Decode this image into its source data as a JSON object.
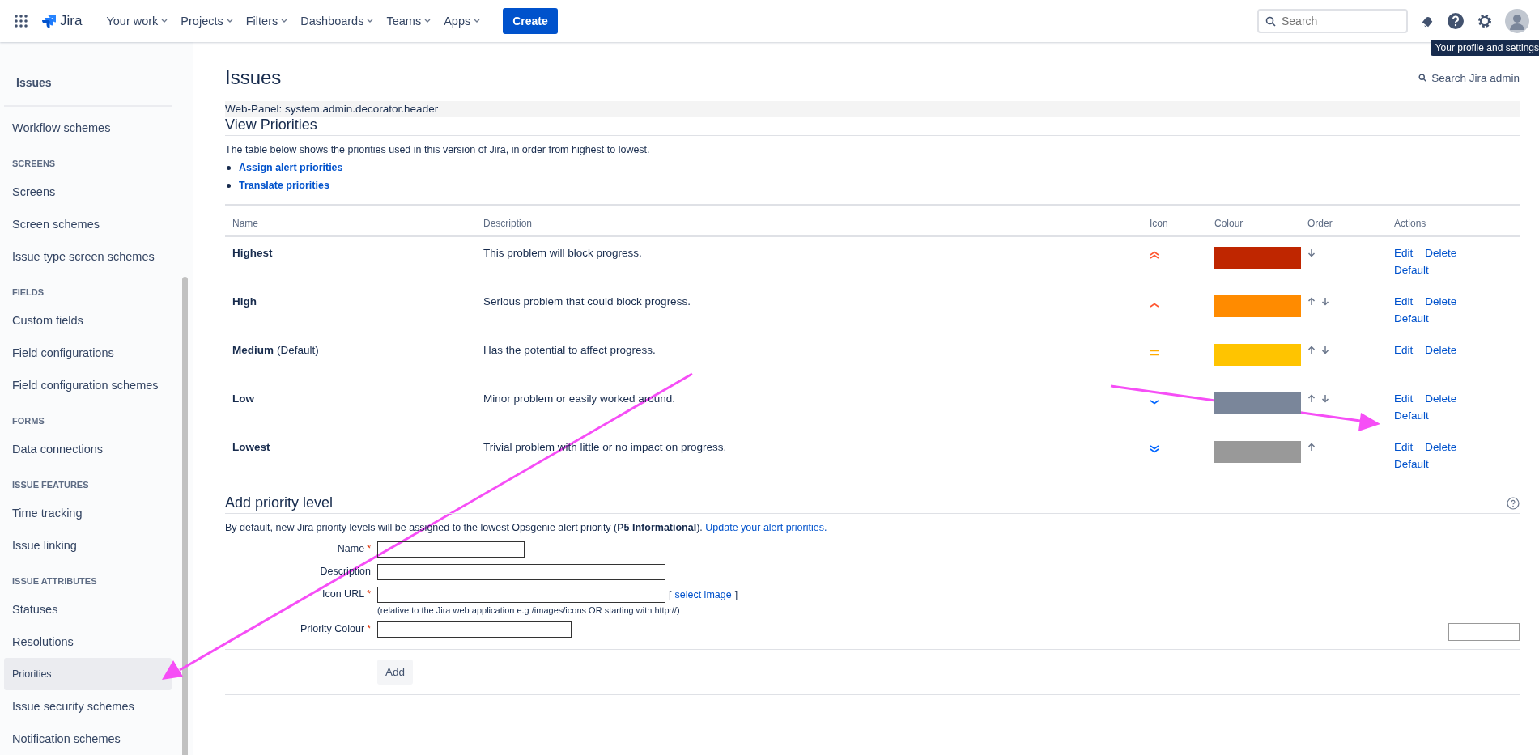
{
  "topbar": {
    "logo": "Jira",
    "menus": [
      {
        "label": "Your work"
      },
      {
        "label": "Projects"
      },
      {
        "label": "Filters"
      },
      {
        "label": "Dashboards"
      },
      {
        "label": "Teams"
      },
      {
        "label": "Apps"
      }
    ],
    "create": "Create",
    "search": {
      "placeholder": "Search"
    },
    "tooltip": "Your profile and settings"
  },
  "sidebar": {
    "title": "Issues",
    "sections": [
      {
        "items": [
          {
            "label": "Workflow schemes",
            "selected": false
          }
        ]
      },
      {
        "heading": "SCREENS",
        "items": [
          {
            "label": "Screens",
            "selected": false
          },
          {
            "label": "Screen schemes",
            "selected": false
          },
          {
            "label": "Issue type screen schemes",
            "selected": false
          }
        ]
      },
      {
        "heading": "FIELDS",
        "items": [
          {
            "label": "Custom fields",
            "selected": false
          },
          {
            "label": "Field configurations",
            "selected": false
          },
          {
            "label": "Field configuration schemes",
            "selected": false
          }
        ]
      },
      {
        "heading": "FORMS",
        "items": [
          {
            "label": "Data connections",
            "selected": false
          }
        ]
      },
      {
        "heading": "ISSUE FEATURES",
        "items": [
          {
            "label": "Time tracking",
            "selected": false
          },
          {
            "label": "Issue linking",
            "selected": false
          }
        ]
      },
      {
        "heading": "ISSUE ATTRIBUTES",
        "items": [
          {
            "label": "Statuses",
            "selected": false
          },
          {
            "label": "Resolutions",
            "selected": false
          },
          {
            "label": "Priorities",
            "selected": true
          },
          {
            "label": "Issue security schemes",
            "selected": false
          },
          {
            "label": "Notification schemes",
            "selected": false
          }
        ]
      }
    ]
  },
  "page": {
    "title": "Issues",
    "admin_search": "Search Jira admin",
    "web_panel": "Web-Panel: system.admin.decorator.header",
    "section_title": "View Priorities",
    "intro": "The table below shows the priorities used in this version of Jira, in order from highest to lowest.",
    "links": [
      "Assign alert priorities",
      "Translate priorities"
    ]
  },
  "table": {
    "columns": [
      "Name",
      "Description",
      "Icon",
      "Colour",
      "Order",
      "Actions"
    ],
    "rows": [
      {
        "name": "Highest",
        "note": null,
        "description": "This problem will block progress.",
        "kind": "highest",
        "color": "#bf2600",
        "up": false,
        "down": true,
        "actions": [
          "Edit",
          "Delete",
          "Default"
        ]
      },
      {
        "name": "High",
        "note": null,
        "description": "Serious problem that could block progress.",
        "kind": "high",
        "color": "#ff8b00",
        "up": true,
        "down": true,
        "actions": [
          "Edit",
          "Delete",
          "Default"
        ]
      },
      {
        "name": "Medium",
        "note": "(Default)",
        "description": "Has the potential to affect progress.",
        "kind": "medium",
        "color": "#ffc400",
        "up": true,
        "down": true,
        "actions": [
          "Edit",
          "Delete"
        ]
      },
      {
        "name": "Low",
        "note": null,
        "description": "Minor problem or easily worked around.",
        "kind": "low",
        "color": "#7a869a",
        "up": true,
        "down": true,
        "actions": [
          "Edit",
          "Delete",
          "Default"
        ]
      },
      {
        "name": "Lowest",
        "note": null,
        "description": "Trivial problem with little or no impact on progress.",
        "kind": "lowest",
        "color": "#999999",
        "up": true,
        "down": false,
        "actions": [
          "Edit",
          "Delete",
          "Default"
        ]
      }
    ]
  },
  "add_form": {
    "title": "Add priority level",
    "text": "By default, new Jira priority levels will be assigned to the lowest Opsgenie alert priority (**P5 Informational**).",
    "link": "Update your alert priorities.",
    "fields": [
      {
        "label": "Name",
        "required_mark": "*"
      },
      {
        "label": "Description"
      },
      {
        "label": "Icon URL",
        "required_mark": "*",
        "link_open": "[",
        "link": "select image",
        "link_close": "]",
        "hint": "(relative to the Jira web application e.g /images/icons OR starting with http://)"
      },
      {
        "label": "Priority Colour",
        "required_mark": "*"
      }
    ],
    "button": "Add"
  }
}
